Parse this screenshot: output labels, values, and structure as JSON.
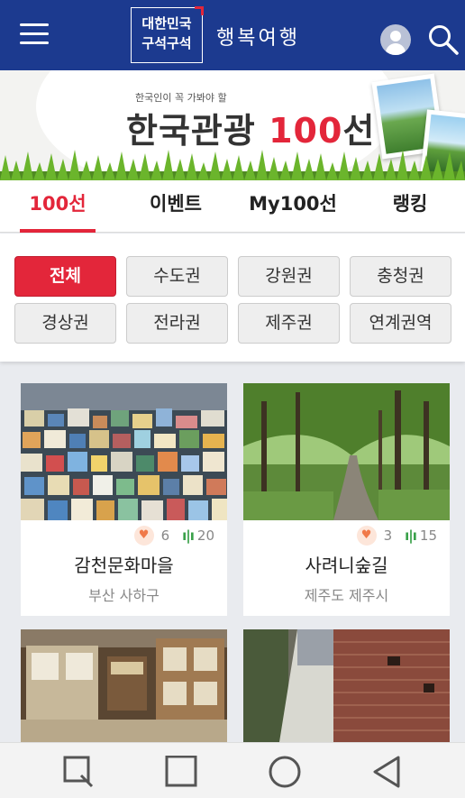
{
  "header": {
    "logo_line1": "대한민국",
    "logo_line2": "구석구석",
    "brand": "행복여행",
    "icons": {
      "menu": "menu-icon",
      "profile": "avatar-icon",
      "search": "search-icon"
    }
  },
  "banner": {
    "subtitle": "한국인이 꼭 가봐야 할",
    "title_text": "한국관광 ",
    "title_number": "100",
    "title_suffix": "선"
  },
  "tabs": [
    {
      "label": "100선",
      "active": true
    },
    {
      "label": "이벤트",
      "active": false
    },
    {
      "label": "My100선",
      "active": false
    },
    {
      "label": "랭킹",
      "active": false
    }
  ],
  "regions": [
    {
      "label": "전체",
      "active": true
    },
    {
      "label": "수도권",
      "active": false
    },
    {
      "label": "강원권",
      "active": false
    },
    {
      "label": "충청권",
      "active": false
    },
    {
      "label": "경상권",
      "active": false
    },
    {
      "label": "전라권",
      "active": false
    },
    {
      "label": "제주권",
      "active": false
    },
    {
      "label": "연계권역",
      "active": false
    }
  ],
  "cards": [
    {
      "name": "감천문화마을",
      "location": "부산 사하구",
      "likes": "6",
      "views": "20"
    },
    {
      "name": "사려니숲길",
      "location": "제주도 제주시",
      "likes": "3",
      "views": "15"
    },
    {
      "name": "",
      "location": "",
      "likes": "",
      "views": ""
    },
    {
      "name": "",
      "location": "",
      "likes": "",
      "views": ""
    }
  ],
  "navbar": {
    "icons": [
      "recents-square-icon",
      "home-square-icon",
      "home-circle-icon",
      "back-triangle-icon"
    ]
  },
  "colors": {
    "header": "#1c3a8f",
    "accent": "#e3263a",
    "views": "#3aa14a",
    "likes": "#f07a4a"
  }
}
